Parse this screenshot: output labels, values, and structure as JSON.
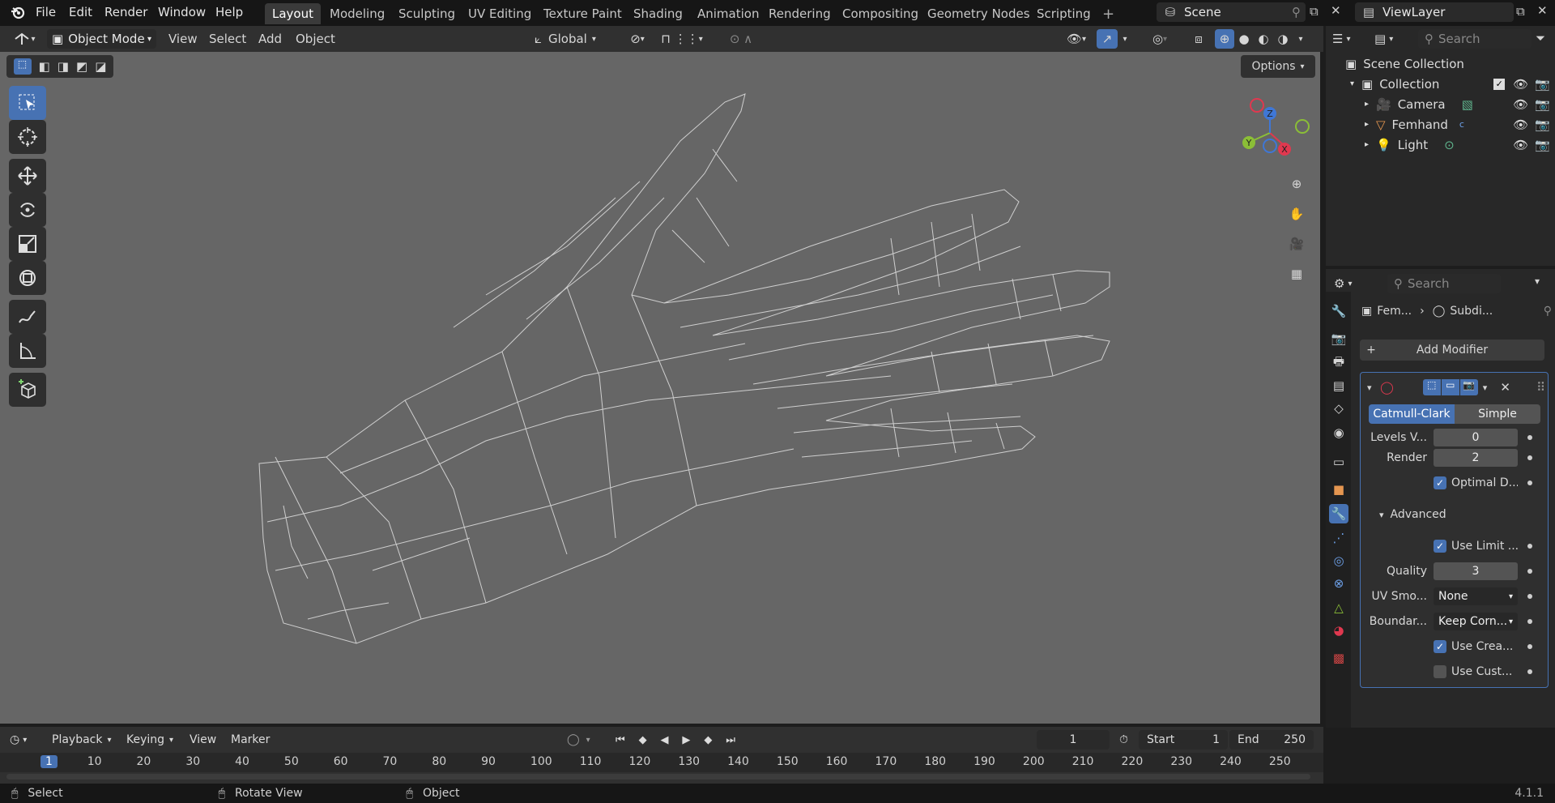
{
  "menubar": {
    "file": "File",
    "edit": "Edit",
    "render": "Render",
    "window": "Window",
    "help": "Help"
  },
  "workspaces": [
    "Layout",
    "Modeling",
    "Sculpting",
    "UV Editing",
    "Texture Paint",
    "Shading",
    "Animation",
    "Rendering",
    "Compositing",
    "Geometry Nodes",
    "Scripting"
  ],
  "scene": "Scene",
  "viewlayer": "ViewLayer",
  "vp_header": {
    "mode": "Object Mode",
    "view": "View",
    "select": "Select",
    "add": "Add",
    "object": "Object",
    "orientation": "Global",
    "options": "Options"
  },
  "gizmo": {
    "x": "X",
    "y": "Y",
    "z": "Z"
  },
  "outliner": {
    "search": "Search",
    "root": "Scene Collection",
    "collection": "Collection",
    "items": [
      "Camera",
      "Femhand",
      "Light"
    ]
  },
  "properties": {
    "search": "Search",
    "breadcrumb_obj": "Fem...",
    "breadcrumb_mod": "Subdi...",
    "add_modifier": "Add Modifier",
    "types": [
      "Catmull-Clark",
      "Simple"
    ],
    "levels_label": "Levels V...",
    "levels_value": "0",
    "render_label": "Render",
    "render_value": "2",
    "optimal": "Optimal D...",
    "advanced": "Advanced",
    "use_limit": "Use Limit ...",
    "quality_label": "Quality",
    "quality_value": "3",
    "uvsmooth_label": "UV Smo...",
    "uvsmooth_value": "None",
    "boundary_label": "Boundar...",
    "boundary_value": "Keep Corn...",
    "use_crease": "Use Crea...",
    "use_custom": "Use Cust..."
  },
  "timeline": {
    "playback": "Playback",
    "keying": "Keying",
    "view": "View",
    "marker": "Marker",
    "current": "1",
    "start_label": "Start",
    "start": "1",
    "end_label": "End",
    "end": "250",
    "ticks": [
      "1",
      "10",
      "20",
      "30",
      "40",
      "50",
      "60",
      "70",
      "80",
      "90",
      "100",
      "110",
      "120",
      "130",
      "140",
      "150",
      "160",
      "170",
      "180",
      "190",
      "200",
      "210",
      "220",
      "230",
      "240",
      "250"
    ]
  },
  "status": {
    "select": "Select",
    "rotate": "Rotate View",
    "object": "Object",
    "version": "4.1.1"
  },
  "colors": {
    "accent": "#4772b3",
    "viewport": "#666666",
    "wire": "#d8d8d8",
    "x_axis": "#e0384f",
    "y_axis": "#8bbe37",
    "z_axis": "#3f77d6"
  }
}
